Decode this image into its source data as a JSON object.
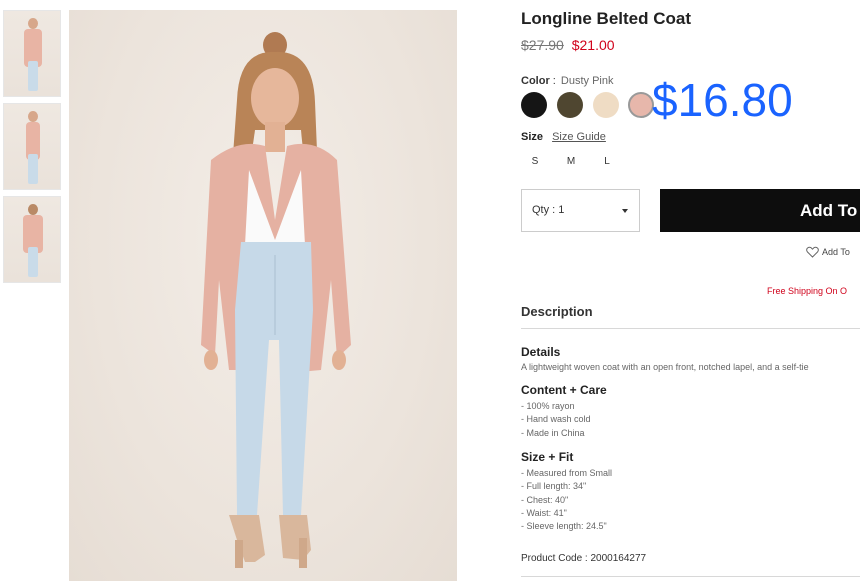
{
  "gallery": {
    "thumbnails": [
      "front view",
      "side view",
      "back view"
    ],
    "main_alt": "Model wearing Dusty Pink longline belted coat"
  },
  "product": {
    "title": "Longline Belted Coat",
    "original_price": "$27.90",
    "sale_price": "$21.00",
    "overlay_price": "$16.80"
  },
  "color": {
    "label": "Color",
    "separator": ":",
    "selected": "Dusty Pink",
    "swatches": [
      {
        "name": "Black",
        "hex": "#151515"
      },
      {
        "name": "Olive",
        "hex": "#4f4630"
      },
      {
        "name": "Cream",
        "hex": "#efdcc4"
      },
      {
        "name": "Dusty Pink",
        "hex": "#e7b7ab"
      }
    ]
  },
  "size": {
    "label": "Size",
    "guide": "Size Guide",
    "options": [
      "S",
      "M",
      "L"
    ]
  },
  "qty": {
    "label": "Qty : 1"
  },
  "cart": {
    "add_button": "Add To",
    "wishlist": "Add To",
    "shipping": "Free Shipping On O"
  },
  "description": {
    "heading": "Description",
    "details_title": "Details",
    "details_text": "A lightweight woven coat with an open front, notched lapel, and a self-tie",
    "care_title": "Content + Care",
    "care_lines": [
      "- 100% rayon",
      "- Hand wash cold",
      "- Made in China"
    ],
    "fit_title": "Size + Fit",
    "fit_lines": [
      "- Measured from Small",
      "- Full length: 34\"",
      "- Chest: 40\"",
      "- Waist: 41\"",
      "- Sleeve length: 24.5\""
    ],
    "product_code": "Product Code : 2000164277"
  }
}
